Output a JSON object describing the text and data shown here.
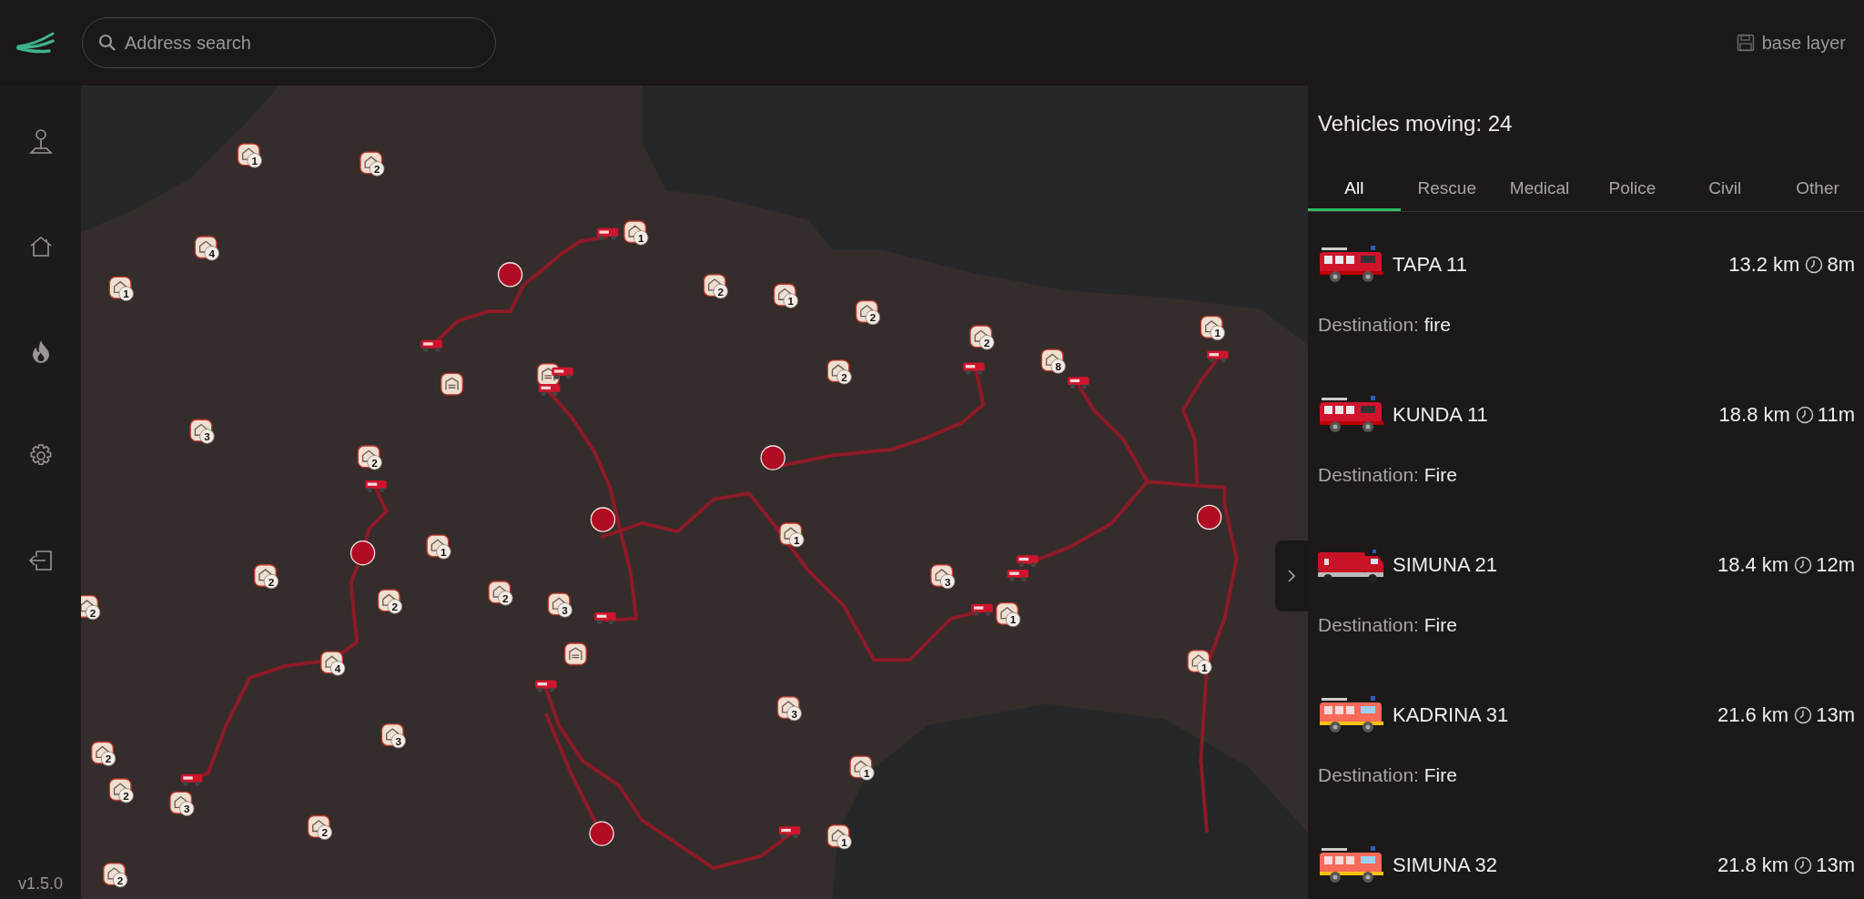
{
  "topbar": {
    "search": {
      "placeholder": "Address search"
    },
    "base_layer_button": "base layer"
  },
  "sidebar": {
    "version": "v1.5.0"
  },
  "map": {
    "station_markers": [
      {
        "count": "1"
      },
      {
        "count": "2"
      },
      {
        "count": "4"
      },
      {
        "count": "1"
      },
      {
        "count": "1"
      },
      {
        "count": "2"
      },
      {
        "count": "1"
      },
      {
        "count": "2"
      },
      {
        "count": "2"
      },
      {
        "count": "8"
      },
      {
        "count": "1"
      },
      {
        "count": "2"
      },
      {
        "kind": "single"
      },
      {
        "kind": "single"
      },
      {
        "count": "3"
      },
      {
        "count": "2"
      },
      {
        "count": "1"
      },
      {
        "count": "1"
      },
      {
        "count": "2"
      },
      {
        "count": "2"
      },
      {
        "count": "2"
      },
      {
        "count": "2"
      },
      {
        "count": "3"
      },
      {
        "count": "3"
      },
      {
        "count": "1"
      },
      {
        "kind": "single"
      },
      {
        "count": "4"
      },
      {
        "count": "1"
      },
      {
        "count": "3"
      },
      {
        "count": "3"
      },
      {
        "count": "2"
      },
      {
        "count": "2"
      },
      {
        "count": "3"
      },
      {
        "count": "1"
      },
      {
        "count": "2"
      },
      {
        "count": "1"
      },
      {
        "count": "2"
      }
    ]
  },
  "panel": {
    "title": "Vehicles moving: 24",
    "tabs": [
      {
        "label": "All",
        "selected": true
      },
      {
        "label": "Rescue",
        "selected": false
      },
      {
        "label": "Medical",
        "selected": false
      },
      {
        "label": "Police",
        "selected": false
      },
      {
        "label": "Civil",
        "selected": false
      },
      {
        "label": "Other",
        "selected": false
      }
    ],
    "vehicles": [
      {
        "kind": "engine",
        "name": "TAPA 11",
        "distance": "13.2 km",
        "eta": "8m",
        "destination_label": "Destination:",
        "destination": "fire"
      },
      {
        "kind": "engine",
        "name": "KUNDA 11",
        "distance": "18.8 km",
        "eta": "11m",
        "destination_label": "Destination:",
        "destination": "Fire"
      },
      {
        "kind": "tanker",
        "name": "SIMUNA 21",
        "distance": "18.4 km",
        "eta": "12m",
        "destination_label": "Destination:",
        "destination": "Fire"
      },
      {
        "kind": "light",
        "name": "KADRINA 31",
        "distance": "21.6 km",
        "eta": "13m",
        "destination_label": "Destination:",
        "destination": "Fire"
      },
      {
        "kind": "light",
        "name": "SIMUNA 32",
        "distance": "21.8 km",
        "eta": "13m"
      }
    ]
  }
}
